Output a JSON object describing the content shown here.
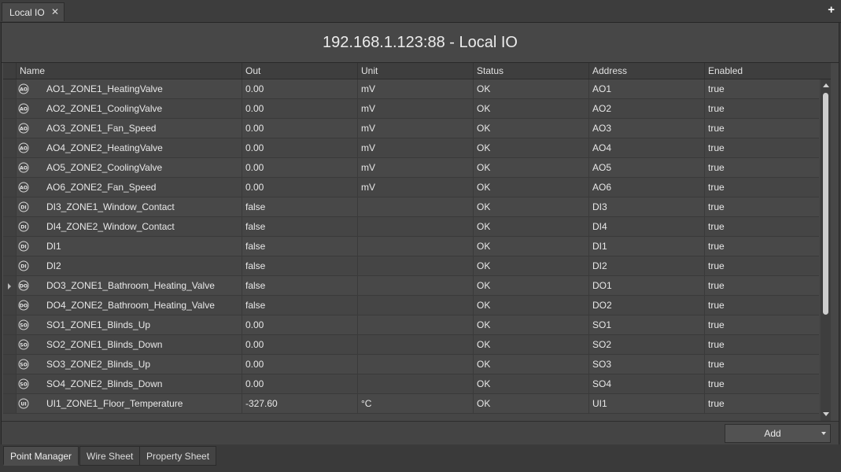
{
  "window": {
    "tab_label": "Local IO",
    "close_glyph": "✕",
    "new_tab_glyph": "+"
  },
  "title": "192.168.1.123:88 - Local IO",
  "table": {
    "columns": [
      "Name",
      "Out",
      "Unit",
      "Status",
      "Address",
      "Enabled"
    ],
    "rows": [
      {
        "icon": "AO",
        "name": "AO1_ZONE1_HeatingValve",
        "out": "0.00",
        "unit": "mV",
        "status": "OK",
        "address": "AO1",
        "enabled": "true"
      },
      {
        "icon": "AO",
        "name": "AO2_ZONE1_CoolingValve",
        "out": "0.00",
        "unit": "mV",
        "status": "OK",
        "address": "AO2",
        "enabled": "true"
      },
      {
        "icon": "AO",
        "name": "AO3_ZONE1_Fan_Speed",
        "out": "0.00",
        "unit": "mV",
        "status": "OK",
        "address": "AO3",
        "enabled": "true"
      },
      {
        "icon": "AO",
        "name": "AO4_ZONE2_HeatingValve",
        "out": "0.00",
        "unit": "mV",
        "status": "OK",
        "address": "AO4",
        "enabled": "true"
      },
      {
        "icon": "AO",
        "name": "AO5_ZONE2_CoolingValve",
        "out": "0.00",
        "unit": "mV",
        "status": "OK",
        "address": "AO5",
        "enabled": "true"
      },
      {
        "icon": "AO",
        "name": "AO6_ZONE2_Fan_Speed",
        "out": "0.00",
        "unit": "mV",
        "status": "OK",
        "address": "AO6",
        "enabled": "true"
      },
      {
        "icon": "DI",
        "name": "DI3_ZONE1_Window_Contact",
        "out": "false",
        "unit": "",
        "status": "OK",
        "address": "DI3",
        "enabled": "true"
      },
      {
        "icon": "DI",
        "name": "DI4_ZONE2_Window_Contact",
        "out": "false",
        "unit": "",
        "status": "OK",
        "address": "DI4",
        "enabled": "true"
      },
      {
        "icon": "DI",
        "name": "DI1",
        "out": "false",
        "unit": "",
        "status": "OK",
        "address": "DI1",
        "enabled": "true"
      },
      {
        "icon": "DI",
        "name": "DI2",
        "out": "false",
        "unit": "",
        "status": "OK",
        "address": "DI2",
        "enabled": "true"
      },
      {
        "icon": "DO",
        "name": "DO3_ZONE1_Bathroom_Heating_Valve",
        "out": "false",
        "unit": "",
        "status": "OK",
        "address": "DO1",
        "enabled": "true",
        "marker": true
      },
      {
        "icon": "DO",
        "name": "DO4_ZONE2_Bathroom_Heating_Valve",
        "out": "false",
        "unit": "",
        "status": "OK",
        "address": "DO2",
        "enabled": "true"
      },
      {
        "icon": "SO",
        "name": "SO1_ZONE1_Blinds_Up",
        "out": "0.00",
        "unit": "",
        "status": "OK",
        "address": "SO1",
        "enabled": "true"
      },
      {
        "icon": "SO",
        "name": "SO2_ZONE1_Blinds_Down",
        "out": "0.00",
        "unit": "",
        "status": "OK",
        "address": "SO2",
        "enabled": "true"
      },
      {
        "icon": "SO",
        "name": "SO3_ZONE2_Blinds_Up",
        "out": "0.00",
        "unit": "",
        "status": "OK",
        "address": "SO3",
        "enabled": "true"
      },
      {
        "icon": "SO",
        "name": "SO4_ZONE2_Blinds_Down",
        "out": "0.00",
        "unit": "",
        "status": "OK",
        "address": "SO4",
        "enabled": "true"
      },
      {
        "icon": "UI",
        "name": "UI1_ZONE1_Floor_Temperature",
        "out": "-327.60",
        "unit": "°C",
        "status": "OK",
        "address": "UI1",
        "enabled": "true"
      }
    ]
  },
  "bottom": {
    "add_label": "Add"
  },
  "view_tabs": [
    {
      "label": "Point Manager",
      "active": true
    },
    {
      "label": "Wire Sheet",
      "active": false
    },
    {
      "label": "Property Sheet",
      "active": false
    }
  ]
}
